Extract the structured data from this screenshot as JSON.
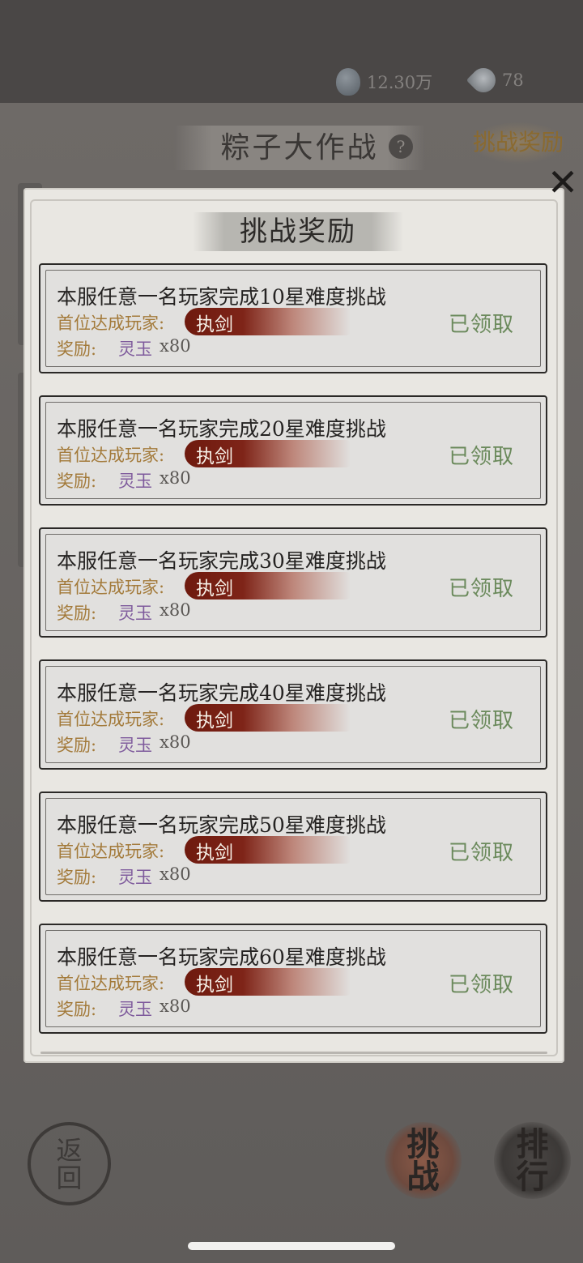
{
  "topbar": {
    "currency1": "12.30万",
    "currency2": "78"
  },
  "background": {
    "title": "粽子大作战",
    "help": "?",
    "reward_button": "挑战奖励"
  },
  "modal": {
    "title": "挑战奖励",
    "close": "✕",
    "first_label": "首位达成玩家:",
    "reward_label": "奖励:",
    "items": [
      {
        "task": "本服任意一名玩家完成10星难度挑战",
        "player": "执剑",
        "reward_item": "灵玉",
        "reward_qty": "x80",
        "status": "已领取"
      },
      {
        "task": "本服任意一名玩家完成20星难度挑战",
        "player": "执剑",
        "reward_item": "灵玉",
        "reward_qty": "x80",
        "status": "已领取"
      },
      {
        "task": "本服任意一名玩家完成30星难度挑战",
        "player": "执剑",
        "reward_item": "灵玉",
        "reward_qty": "x80",
        "status": "已领取"
      },
      {
        "task": "本服任意一名玩家完成40星难度挑战",
        "player": "执剑",
        "reward_item": "灵玉",
        "reward_qty": "x80",
        "status": "已领取"
      },
      {
        "task": "本服任意一名玩家完成50星难度挑战",
        "player": "执剑",
        "reward_item": "灵玉",
        "reward_qty": "x80",
        "status": "已领取"
      },
      {
        "task": "本服任意一名玩家完成60星难度挑战",
        "player": "执剑",
        "reward_item": "灵玉",
        "reward_qty": "x80",
        "status": "已领取"
      }
    ]
  },
  "bottom": {
    "back_top": "返",
    "back_bottom": "回",
    "challenge_top": "挑",
    "challenge_bottom": "战",
    "rank_top": "排",
    "rank_bottom": "行"
  }
}
